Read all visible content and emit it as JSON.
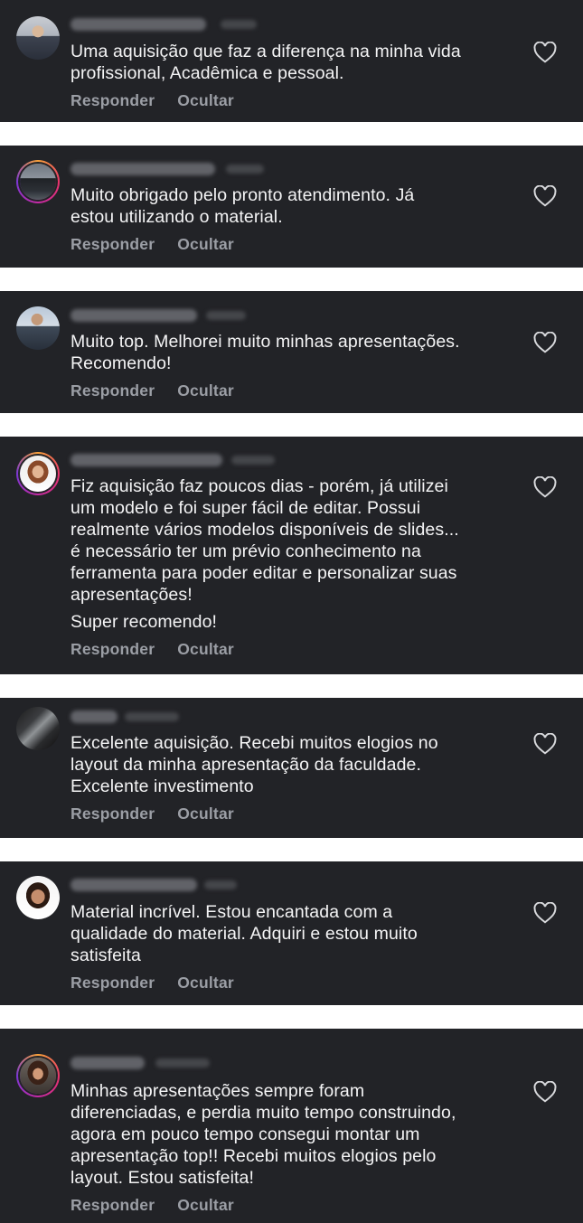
{
  "ui": {
    "accent_ring": [
      "#f9a23a",
      "#e8336a",
      "#c32aa3",
      "#7a37d4"
    ],
    "card_bg": "#222327"
  },
  "comments": [
    {
      "text": "Uma aquisição que faz a diferença na minha vida\nprofissional, Acadêmica e pessoal.",
      "reply": "Responder",
      "hide": "Ocultar",
      "like_icon": "heart-icon"
    },
    {
      "text": "Muito obrigado pelo pronto atendimento. Já\nestou utilizando o material.",
      "reply": "Responder",
      "hide": "Ocultar",
      "like_icon": "heart-icon"
    },
    {
      "text": "Muito top. Melhorei muito minhas apresentações.\nRecomendo!",
      "reply": "Responder",
      "hide": "Ocultar",
      "like_icon": "heart-icon"
    },
    {
      "text": "Fiz aquisição faz poucos dias - porém, já utilizei\num modelo e foi super fácil de editar. Possui\nrealmente vários modelos disponíveis de slides...\né necessário ter um prévio conhecimento na\nferramenta para poder editar e personalizar suas\napresentações!",
      "text2": "Super recomendo!",
      "reply": "Responder",
      "hide": "Ocultar",
      "like_icon": "heart-icon"
    },
    {
      "text": "Excelente aquisição. Recebi muitos elogios no\nlayout da minha apresentação da faculdade.\nExcelente investimento",
      "reply": "Responder",
      "hide": "Ocultar",
      "like_icon": "heart-icon"
    },
    {
      "text": "Material incrível.  Estou encantada com a\nqualidade do material.  Adquiri e estou muito\nsatisfeita",
      "reply": "Responder",
      "hide": "Ocultar",
      "like_icon": "heart-icon"
    },
    {
      "text": "Minhas apresentações sempre foram\ndiferenciadas, e perdia muito tempo construindo,\nagora em pouco tempo consegui montar um\napresentação top!! Recebi muitos elogios pelo\nlayout. Estou satisfeita!",
      "reply": "Responder",
      "hide": "Ocultar",
      "like_icon": "heart-icon"
    }
  ]
}
